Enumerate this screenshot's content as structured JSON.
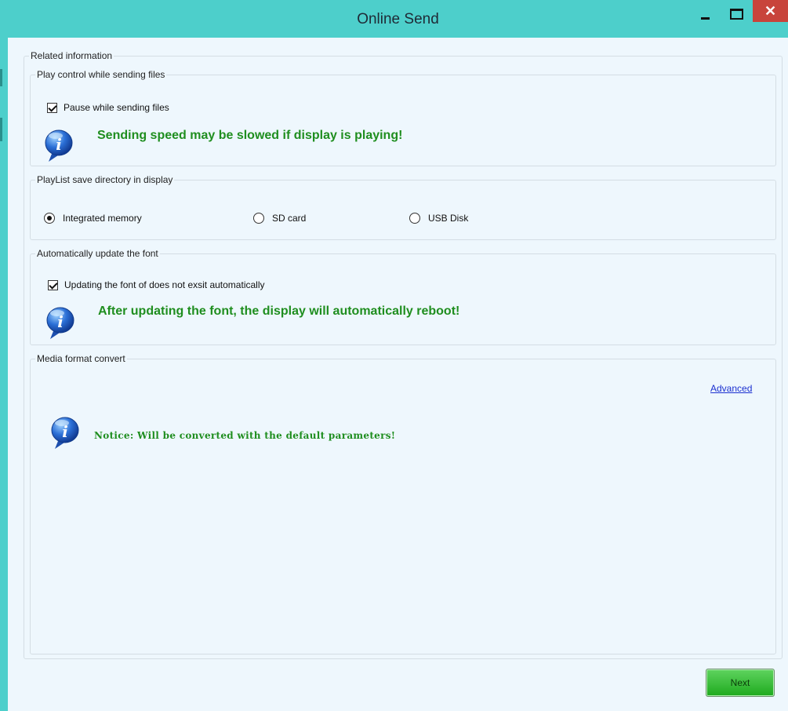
{
  "window": {
    "title": "Online Send",
    "close_glyph": "✕"
  },
  "related": {
    "legend": "Related information"
  },
  "play_control": {
    "legend": "Play control while sending files",
    "pause_label": "Pause while sending files",
    "pause_checked": true,
    "warning": "Sending speed may be slowed if display is playing!"
  },
  "playlist_dir": {
    "legend": "PlayList save directory in display",
    "options": [
      "Integrated memory",
      "SD card",
      "USB Disk"
    ],
    "selected": "Integrated memory"
  },
  "font_update": {
    "legend": "Automatically update the font",
    "checkbox_label": "Updating the font of does not exsit automatically",
    "checked": true,
    "warning": "After updating the font, the display will automatically reboot!"
  },
  "media_convert": {
    "legend": "Media format convert",
    "advanced_link": "Advanced",
    "notice": "Notice: Will be converted with the default parameters!"
  },
  "footer": {
    "next_label": "Next"
  },
  "colors": {
    "titlebar": "#4dcfcb",
    "panel": "#eef7fd",
    "warning_text": "#1f8e1f",
    "link": "#1a2fd0",
    "close_button": "#c8443b"
  },
  "icons": [
    "minimize-icon",
    "maximize-icon",
    "close-icon",
    "info-icon"
  ]
}
